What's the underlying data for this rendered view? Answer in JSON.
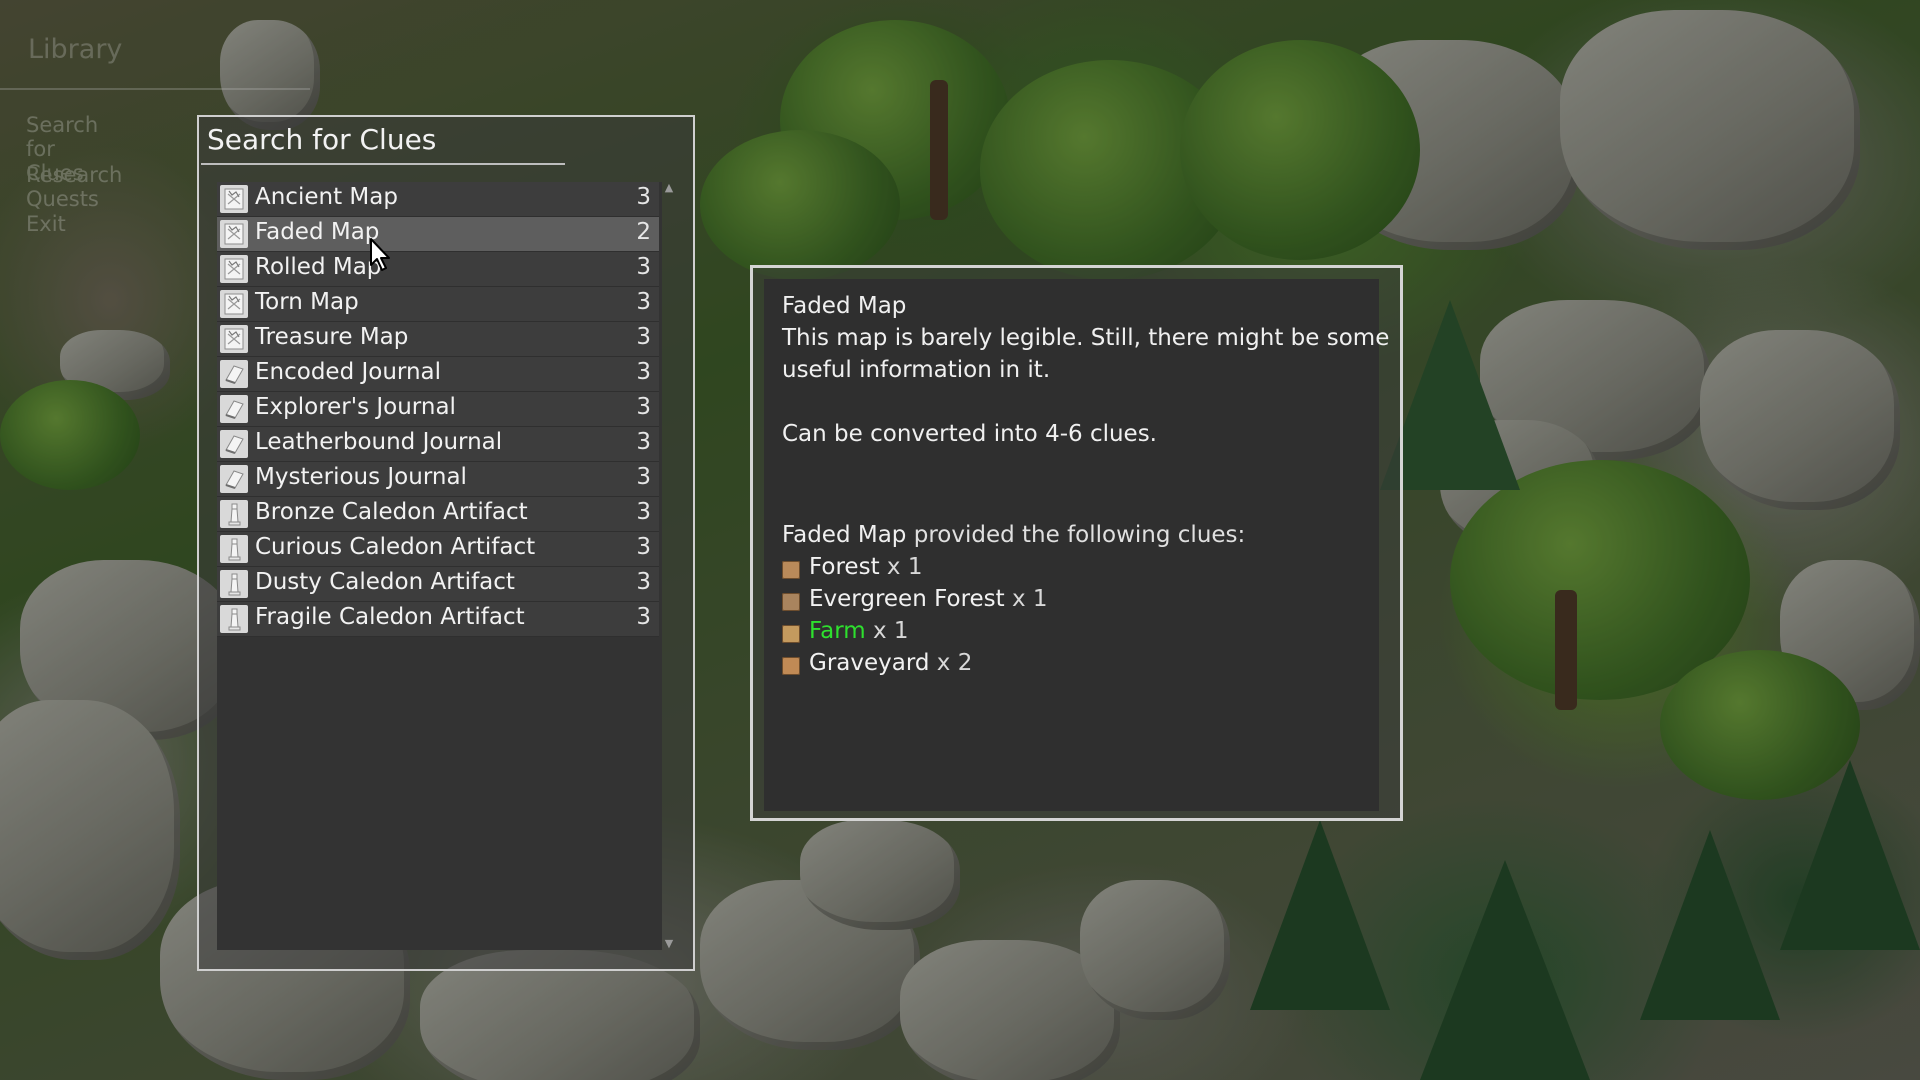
{
  "background_menu": {
    "title": "Library",
    "items": [
      "Search for Clues",
      "Research Quests",
      "Exit"
    ]
  },
  "clues_panel": {
    "title": "Search for Clues",
    "selected_index": 1,
    "items": [
      {
        "name": "Ancient Map",
        "count": "3",
        "icon": "map-icon"
      },
      {
        "name": "Faded Map",
        "count": "2",
        "icon": "map-icon"
      },
      {
        "name": "Rolled Map",
        "count": "3",
        "icon": "map-icon"
      },
      {
        "name": "Torn Map",
        "count": "3",
        "icon": "map-icon"
      },
      {
        "name": "Treasure Map",
        "count": "3",
        "icon": "map-icon"
      },
      {
        "name": "Encoded Journal",
        "count": "3",
        "icon": "journal-icon"
      },
      {
        "name": "Explorer's Journal",
        "count": "3",
        "icon": "journal-icon"
      },
      {
        "name": "Leatherbound Journal",
        "count": "3",
        "icon": "journal-icon"
      },
      {
        "name": "Mysterious Journal",
        "count": "3",
        "icon": "journal-icon"
      },
      {
        "name": "Bronze Caledon Artifact",
        "count": "3",
        "icon": "artifact-icon"
      },
      {
        "name": "Curious Caledon Artifact",
        "count": "3",
        "icon": "artifact-icon"
      },
      {
        "name": "Dusty Caledon Artifact",
        "count": "3",
        "icon": "artifact-icon"
      },
      {
        "name": "Fragile Caledon Artifact",
        "count": "3",
        "icon": "artifact-icon"
      }
    ]
  },
  "detail": {
    "title": "Faded Map",
    "description_line1": "This map is barely legible. Still, there might be some",
    "description_line2": "useful information in it.",
    "convert_text": "Can be converted into 4-6 clues.",
    "provided_item": "Faded Map",
    "provided_suffix": " provided the following clues:",
    "clues": [
      {
        "name": "Forest",
        "qty": " x 1",
        "name_color": "#f2f2f2",
        "icon_color": "#b98a5a",
        "icon": "forest-tile-icon"
      },
      {
        "name": "Evergreen Forest",
        "qty": " x 1",
        "name_color": "#f2f2f2",
        "icon_color": "#a9845e",
        "icon": "evergreen-forest-tile-icon"
      },
      {
        "name": "Farm",
        "qty": " x 1",
        "name_color": "#2ee02e",
        "icon_color": "#c49a5e",
        "icon": "farm-tile-icon"
      },
      {
        "name": "Graveyard",
        "qty": " x 2",
        "name_color": "#f2f2f2",
        "icon_color": "#c08a55",
        "icon": "graveyard-tile-icon"
      }
    ]
  }
}
